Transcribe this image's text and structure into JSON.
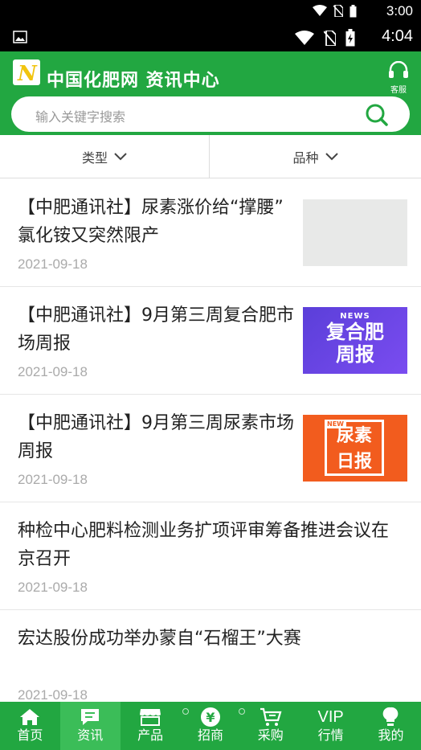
{
  "status": {
    "top_time": "3:00",
    "time": "4:04"
  },
  "header": {
    "title": "中国化肥网 资讯中心",
    "service_label": "客服"
  },
  "search": {
    "placeholder": "输入关键字搜索"
  },
  "filters": [
    {
      "label": "类型"
    },
    {
      "label": "品种"
    }
  ],
  "news": [
    {
      "title": "【中肥通讯社】尿素涨价给“撑腰” 氯化铵又突然限产",
      "date": "2021-09-18",
      "thumb": "gray"
    },
    {
      "title": "【中肥通讯社】9月第三周复合肥市场周报",
      "date": "2021-09-18",
      "thumb": "purple",
      "thumb_top": "NEWS",
      "thumb_line1": "复合肥",
      "thumb_line2": "周报"
    },
    {
      "title": "【中肥通讯社】9月第三周尿素市场周报",
      "date": "2021-09-18",
      "thumb": "orange",
      "thumb_top": "NEW",
      "thumb_line1": "尿素",
      "thumb_line2": "日报"
    },
    {
      "title": "种检中心肥料检测业务扩项评审筹备推进会议在京召开",
      "date": "2021-09-18"
    },
    {
      "title": "宏达股份成功举办蒙自“石榴王”大赛",
      "date": "2021-09-18"
    }
  ],
  "tabbar": [
    {
      "label": "首页",
      "icon": "home-icon"
    },
    {
      "label": "资讯",
      "icon": "message-icon",
      "active": true
    },
    {
      "label": "产品",
      "icon": "store-icon"
    },
    {
      "label": "招商",
      "icon": "yuan-icon",
      "icon_text": "¥"
    },
    {
      "label": "采购",
      "icon": "cart-icon"
    },
    {
      "label": "行情",
      "icon": "vip-icon",
      "icon_text": "VIP"
    },
    {
      "label": "我的",
      "icon": "bulb-icon"
    }
  ],
  "colors": {
    "brand_green": "#22a741",
    "active_tab": "#3bbd58",
    "orange_thumb": "#f25c1e",
    "purple_thumb": "#6a46e6"
  }
}
